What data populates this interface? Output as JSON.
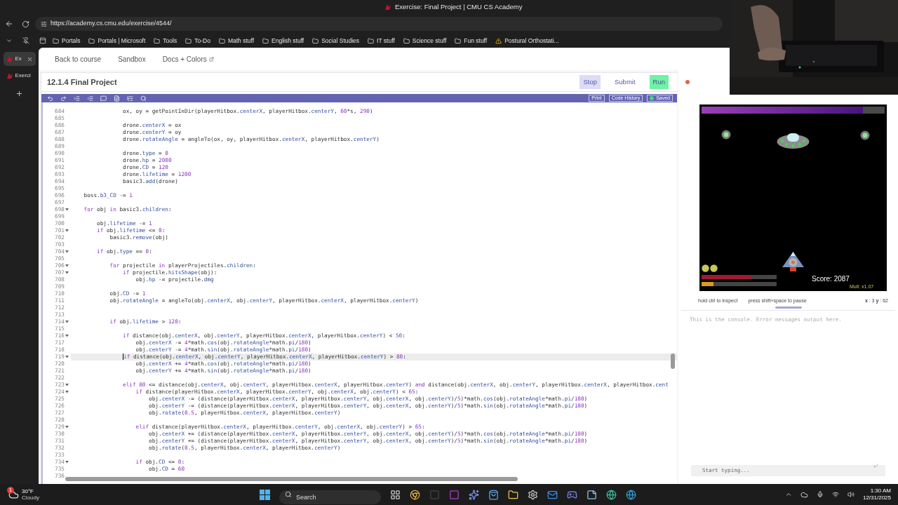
{
  "browser": {
    "window_title": "Exercise: Final Project | CMU CS Academy",
    "url": "https://academy.cs.cmu.edu/exercise/4544/",
    "bookmarks": [
      {
        "label": "Portals",
        "kind": "folder"
      },
      {
        "label": "Portals | Microsoft",
        "kind": "folder"
      },
      {
        "label": "Tools",
        "kind": "folder"
      },
      {
        "label": "To-Do",
        "kind": "folder"
      },
      {
        "label": "Math stuff",
        "kind": "folder"
      },
      {
        "label": "English stuff",
        "kind": "folder"
      },
      {
        "label": "Social Studies",
        "kind": "folder"
      },
      {
        "label": "IT stuff",
        "kind": "folder"
      },
      {
        "label": "Science stuff",
        "kind": "folder"
      },
      {
        "label": "Fun stuff",
        "kind": "folder"
      },
      {
        "label": "Postural Orthostati...",
        "kind": "page"
      }
    ],
    "tabs": [
      {
        "label": "Ex",
        "selected": true
      },
      {
        "label": "Exerci",
        "selected": false
      }
    ]
  },
  "nav": [
    "Back to course",
    "Sandbox",
    "Docs + Colors"
  ],
  "exercise": {
    "title": "12.1.4 Final Project",
    "buttons": [
      {
        "label": "Stop",
        "kind": "stop"
      },
      {
        "label": "Submit",
        "kind": "submit"
      },
      {
        "label": "Run",
        "kind": "run"
      }
    ]
  },
  "editor": {
    "tools": [
      "Print",
      "Code History"
    ],
    "status": "Saved",
    "lines": [
      {
        "n": "684",
        "text": "                ox, oy = getPointInDir(playerHitbox.centerX, playerHitbox.centerY, 60*s, 290)",
        "fold": false,
        "current": false
      },
      {
        "n": "685",
        "fold": false,
        "current": false
      },
      {
        "n": "686",
        "text": "                drone.centerX = ox",
        "fold": false,
        "current": false
      },
      {
        "n": "687",
        "text": "                drone.centerY = oy",
        "fold": false,
        "current": false
      },
      {
        "n": "688",
        "text": "                drone.rotateAngle = angleTo(ox, oy, playerHitbox.centerX, playerHitbox.centerY)",
        "fold": false,
        "current": false
      },
      {
        "n": "689",
        "fold": false,
        "current": false
      },
      {
        "n": "690",
        "text": "                drone.type = 0",
        "fold": false,
        "current": false
      },
      {
        "n": "691",
        "text": "                drone.hp = 2000",
        "fold": false,
        "current": false
      },
      {
        "n": "692",
        "text": "                drone.CD = 120",
        "fold": false,
        "current": false
      },
      {
        "n": "693",
        "text": "                drone.lifetime = 1200",
        "fold": false,
        "current": false
      },
      {
        "n": "694",
        "text": "                basic3.add(drone)",
        "fold": false,
        "current": false
      },
      {
        "n": "695",
        "fold": false,
        "current": false
      },
      {
        "n": "696",
        "text": "    boss.b3_CD -= 1",
        "fold": false,
        "current": false
      },
      {
        "n": "697",
        "fold": false,
        "current": false
      },
      {
        "n": "698",
        "text": "    for obj in basic3.children:",
        "fold": true,
        "current": false
      },
      {
        "n": "699",
        "fold": false,
        "current": false
      },
      {
        "n": "700",
        "text": "        obj.lifetime -= 1",
        "fold": false,
        "current": false
      },
      {
        "n": "701",
        "text": "        if obj.lifetime <= 0:",
        "fold": true,
        "current": false
      },
      {
        "n": "702",
        "text": "            basic3.remove(obj)",
        "fold": false,
        "current": false
      },
      {
        "n": "703",
        "fold": false,
        "current": false
      },
      {
        "n": "704",
        "text": "        if obj.type == 0:",
        "fold": true,
        "current": false
      },
      {
        "n": "705",
        "fold": false,
        "current": false
      },
      {
        "n": "706",
        "text": "            for projectile in playerProjectiles.children:",
        "fold": true,
        "current": false
      },
      {
        "n": "707",
        "text": "                if projectile.hitsShape(obj):",
        "fold": true,
        "current": false
      },
      {
        "n": "708",
        "text": "                    obj.hp -= projectile.dmg",
        "fold": false,
        "current": false
      },
      {
        "n": "709",
        "fold": false,
        "current": false
      },
      {
        "n": "710",
        "text": "            obj.CD -= 1",
        "fold": false,
        "current": false
      },
      {
        "n": "711",
        "text": "            obj.rotateAngle = angleTo(obj.centerX, obj.centerY, playerHitbox.centerX, playerHitbox.centerY)",
        "fold": false,
        "current": false
      },
      {
        "n": "712",
        "fold": false,
        "current": false
      },
      {
        "n": "713",
        "fold": false,
        "current": false
      },
      {
        "n": "714",
        "text": "            if obj.lifetime > 120:",
        "fold": true,
        "current": false
      },
      {
        "n": "715",
        "fold": false,
        "current": false
      },
      {
        "n": "716",
        "text": "                if distance(obj.centerX, obj.centerY, playerHitbox.centerX, playerHitbox.centerY) < 50:",
        "fold": true,
        "current": false
      },
      {
        "n": "717",
        "text": "                    obj.centerX -= 4*math.cos(obj.rotateAngle*math.pi/180)",
        "fold": false,
        "current": false
      },
      {
        "n": "718",
        "text": "                    obj.centerY -= 4*math.sin(obj.rotateAngle*math.pi/180)",
        "fold": false,
        "current": false
      },
      {
        "n": "719",
        "text": "                if distance(obj.centerX, obj.centerY, playerHitbox.centerX, playerHitbox.centerY) > 80:",
        "fold": true,
        "current": true
      },
      {
        "n": "720",
        "text": "                    obj.centerX += 4*math.cos(obj.rotateAngle*math.pi/180)",
        "fold": false,
        "current": false
      },
      {
        "n": "721",
        "text": "                    obj.centerY += 4*math.sin(obj.rotateAngle*math.pi/180)",
        "fold": false,
        "current": false
      },
      {
        "n": "722",
        "fold": false,
        "current": false
      },
      {
        "n": "723",
        "text": "                elif 80 <= distance(obj.centerX, obj.centerY, playerHitbox.centerX, playerHitbox.centerY) and distance(obj.centerX, obj.centerY, playerHitbox.centerX, playerHitbox.cent",
        "fold": true,
        "current": false
      },
      {
        "n": "724",
        "text": "                    if distance(playerHitbox.centerX, playerHitbox.centerY, obj.centerX, obj.centerY) < 65:",
        "fold": true,
        "current": false
      },
      {
        "n": "725",
        "text": "                        obj.centerX -= (distance(playerHitbox.centerX, playerHitbox.centerY, obj.centerX, obj.centerY)/5)*math.cos(obj.rotateAngle*math.pi/180)",
        "fold": false,
        "current": false
      },
      {
        "n": "726",
        "text": "                        obj.centerY -= (distance(playerHitbox.centerX, playerHitbox.centerY, obj.centerX, obj.centerY)/5)*math.sin(obj.rotateAngle*math.pi/180)",
        "fold": false,
        "current": false
      },
      {
        "n": "727",
        "text": "                        obj.rotate(0.5, playerHitbox.centerX, playerHitbox.centerY)",
        "fold": false,
        "current": false
      },
      {
        "n": "728",
        "fold": false,
        "current": false
      },
      {
        "n": "729",
        "text": "                    elif distance(playerHitbox.centerX, playerHitbox.centerY, obj.centerX, obj.centerY) > 65:",
        "fold": true,
        "current": false
      },
      {
        "n": "730",
        "text": "                        obj.centerX += (distance(playerHitbox.centerX, playerHitbox.centerY, obj.centerX, obj.centerY)/5)*math.cos(obj.rotateAngle*math.pi/180)",
        "fold": false,
        "current": false
      },
      {
        "n": "731",
        "text": "                        obj.centerY += (distance(playerHitbox.centerX, playerHitbox.centerY, obj.centerX, obj.centerY)/5)*math.sin(obj.rotateAngle*math.pi/180)",
        "fold": false,
        "current": false
      },
      {
        "n": "732",
        "text": "                        obj.rotate(0.5, playerHitbox.centerX, playerHitbox.centerY)",
        "fold": false,
        "current": false
      },
      {
        "n": "733",
        "fold": false,
        "current": false
      },
      {
        "n": "734",
        "text": "                    if obj.CD <= 0:",
        "fold": true,
        "current": false
      },
      {
        "n": "735",
        "text": "                        obj.CD = 60",
        "fold": false,
        "current": false
      },
      {
        "n": "736",
        "fold": false,
        "current": false
      }
    ]
  },
  "game": {
    "boss_health": {
      "level": 0.88
    },
    "player_health": {
      "level": 0.65
    },
    "energy": {
      "level": 0.16
    },
    "score": "Score: 2087",
    "mult": "Mult: x1.07"
  },
  "hints": [
    "hold ctrl to inspect",
    "press shift+space to pause"
  ],
  "coords": "**x** : 3 **y** : 62",
  "console": {
    "message": "This is the console. Error messages output here.",
    "placeholder": "Start typing..."
  },
  "webcam": {
    "kind": "picture"
  },
  "taskbar": {
    "weather": {
      "badge": "1",
      "temp": "30°F",
      "condition": "Cloudy"
    },
    "search_placeholder": "Search",
    "time": "1:30 AM",
    "date": "12/31/2025"
  }
}
